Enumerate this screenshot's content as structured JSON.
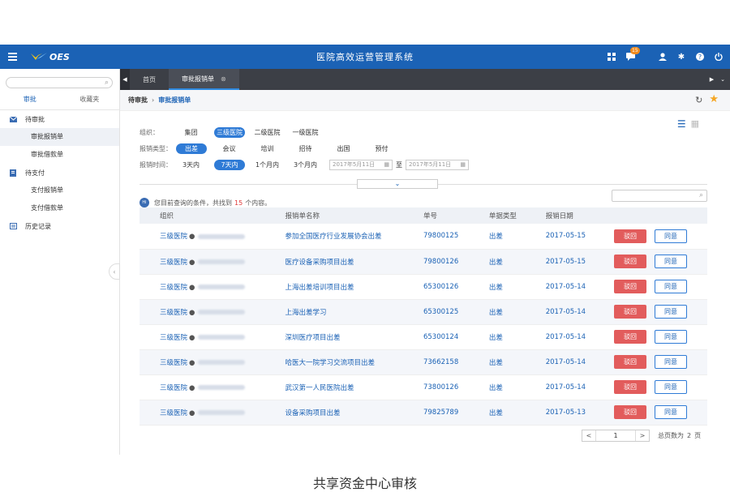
{
  "app": {
    "logo_text": "OES",
    "title": "医院高效运营管理系统",
    "notify_count": "15"
  },
  "sidebar": {
    "tabs": [
      "审批",
      "收藏夹"
    ],
    "groups": [
      {
        "label": "待审批",
        "icon": "inbox-icon",
        "items": [
          "审批报销单",
          "审批借款单"
        ]
      },
      {
        "label": "待支付",
        "icon": "document-icon",
        "items": [
          "支付报销单",
          "支付借款单"
        ]
      },
      {
        "label": "历史记录",
        "icon": "history-icon",
        "items": []
      }
    ],
    "active_item": "审批报销单"
  },
  "tabs": {
    "items": [
      "首页",
      "审批报销单"
    ]
  },
  "breadcrumb": {
    "level1": "待审批",
    "level2": "审批报销单"
  },
  "filters": {
    "org_label": "组织：",
    "org_options": [
      "集团",
      "三级医院",
      "二级医院",
      "一级医院"
    ],
    "org_selected": "三级医院",
    "type_label": "报销类型：",
    "type_options": [
      "出差",
      "会议",
      "培训",
      "招待",
      "出国",
      "预付"
    ],
    "type_selected": "出差",
    "time_label": "报销时间：",
    "time_options": [
      "3天内",
      "7天内",
      "1个月内",
      "3个月内"
    ],
    "time_selected": "7天内",
    "date_from": "2017年5月11日",
    "date_to": "2017年5月11日",
    "date_sep": "至"
  },
  "result": {
    "prefix": "您目前查询的条件，共找到",
    "count": "15",
    "suffix": "个内容。"
  },
  "table": {
    "headers": [
      "组织",
      "报销单名称",
      "单号",
      "单据类型",
      "报销日期",
      ""
    ],
    "rows": [
      {
        "org": "三级医院",
        "name": "参加全国医疗行业发展协会出差",
        "no": "79800125",
        "type": "出差",
        "date": "2017-05-15"
      },
      {
        "org": "三级医院",
        "name": "医疗设备采购项目出差",
        "no": "79800126",
        "type": "出差",
        "date": "2017-05-15"
      },
      {
        "org": "三级医院",
        "name": "上海出差培训项目出差",
        "no": "65300126",
        "type": "出差",
        "date": "2017-05-14"
      },
      {
        "org": "三级医院",
        "name": "上海出差学习",
        "no": "65300125",
        "type": "出差",
        "date": "2017-05-14"
      },
      {
        "org": "三级医院",
        "name": "深圳医疗项目出差",
        "no": "65300124",
        "type": "出差",
        "date": "2017-05-14"
      },
      {
        "org": "三级医院",
        "name": "哈医大一院学习交流项目出差",
        "no": "73662158",
        "type": "出差",
        "date": "2017-05-14"
      },
      {
        "org": "三级医院",
        "name": "武汉第一人民医院出差",
        "no": "73800126",
        "type": "出差",
        "date": "2017-05-14"
      },
      {
        "org": "三级医院",
        "name": "设备采购项目出差",
        "no": "79825789",
        "type": "出差",
        "date": "2017-05-13"
      }
    ],
    "reject_label": "驳回",
    "agree_label": "同意"
  },
  "pager": {
    "prev": "<",
    "page": "1",
    "next": ">",
    "total_label": "总页数为",
    "total_pages": "2",
    "total_unit": "页"
  },
  "caption": "共享资金中心审核"
}
